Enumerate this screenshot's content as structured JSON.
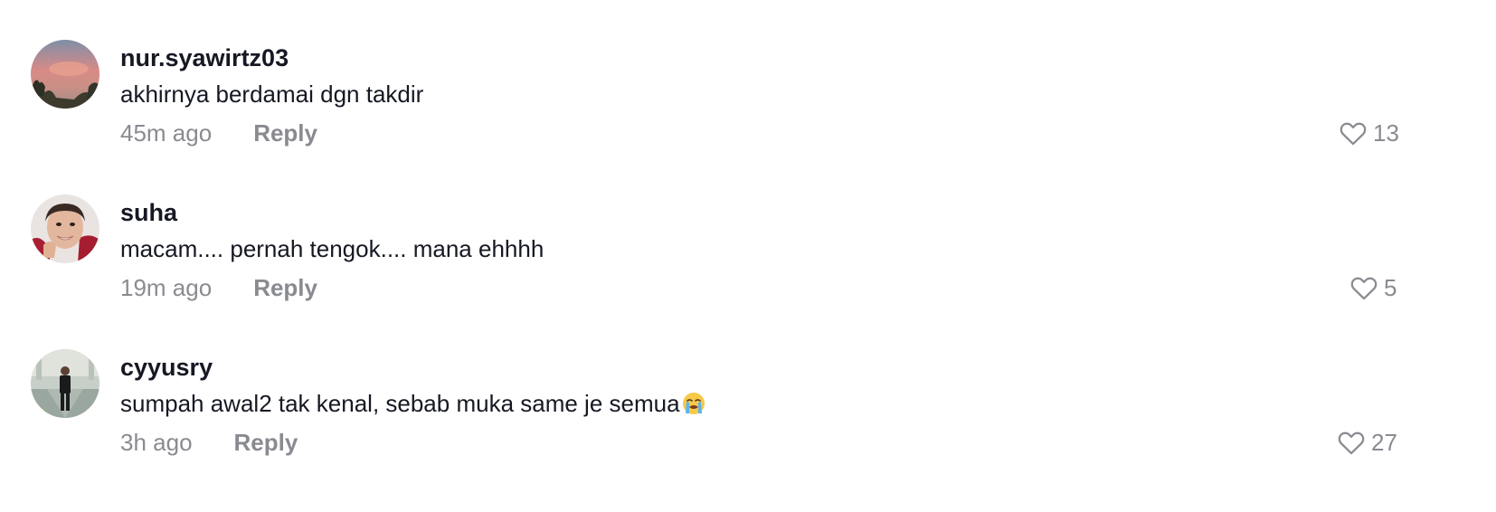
{
  "comments": [
    {
      "username": "nur.syawirtz03",
      "text": "akhirnya berdamai dgn takdir",
      "time": "45m ago",
      "reply_label": "Reply",
      "likes": "13",
      "avatar_icon": "sunset-sky-avatar",
      "emoji": ""
    },
    {
      "username": "suha",
      "text": "macam.... pernah tengok.... mana ehhhh",
      "time": "19m ago",
      "reply_label": "Reply",
      "likes": "5",
      "avatar_icon": "selfie-avatar",
      "emoji": ""
    },
    {
      "username": "cyyusry",
      "text": "sumpah awal2 tak kenal, sebab muka same je semua",
      "time": "3h ago",
      "reply_label": "Reply",
      "likes": "27",
      "avatar_icon": "person-standing-avatar",
      "emoji": "loudly-crying-face"
    }
  ],
  "colors": {
    "text_primary": "#161823",
    "text_secondary": "#8a8b91",
    "background": "#ffffff"
  }
}
